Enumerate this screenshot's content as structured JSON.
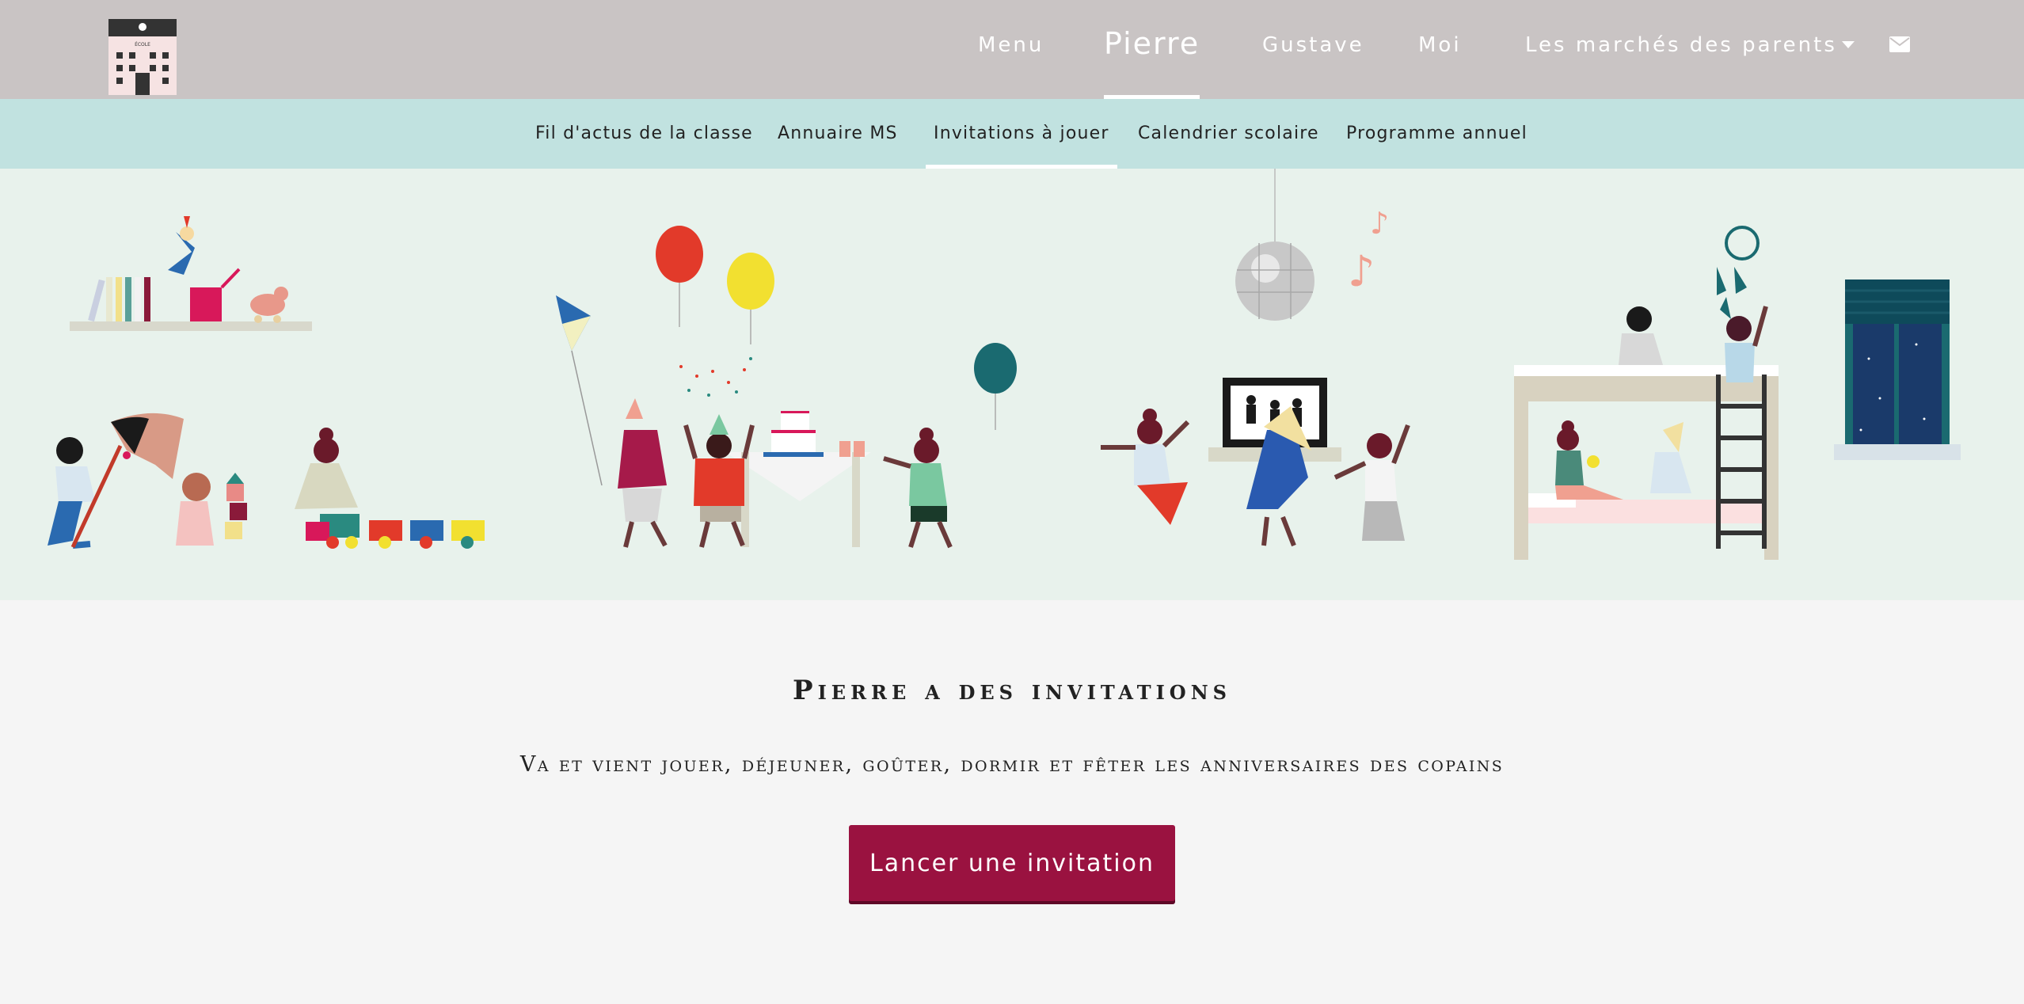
{
  "topnav": {
    "logo_text": "ÉCOLE",
    "items": [
      "Menu",
      "Pierre",
      "Gustave",
      "Moi",
      "Les marchés des parents"
    ],
    "active": "Pierre"
  },
  "subnav": {
    "items": [
      "Fil d'actus de la classe",
      "Annuaire MS",
      "Invitations à jouer",
      "Calendrier scolaire",
      "Programme annuel"
    ],
    "active": "Invitations à jouer"
  },
  "content": {
    "headline": "Pierre a des invitations",
    "subline": "Va et vient jouer, déjeuner, goûter, dormir et fêter les anniversaires des copains",
    "cta_label": "Lancer une invitation"
  },
  "icons": [
    "school-logo-icon",
    "caret-down-icon",
    "envelope-icon"
  ],
  "colors": {
    "topbar": "#c9c4c4",
    "subbar": "#c1e2e0",
    "hero": "#e8f2ec",
    "cta": "#9a1240"
  }
}
